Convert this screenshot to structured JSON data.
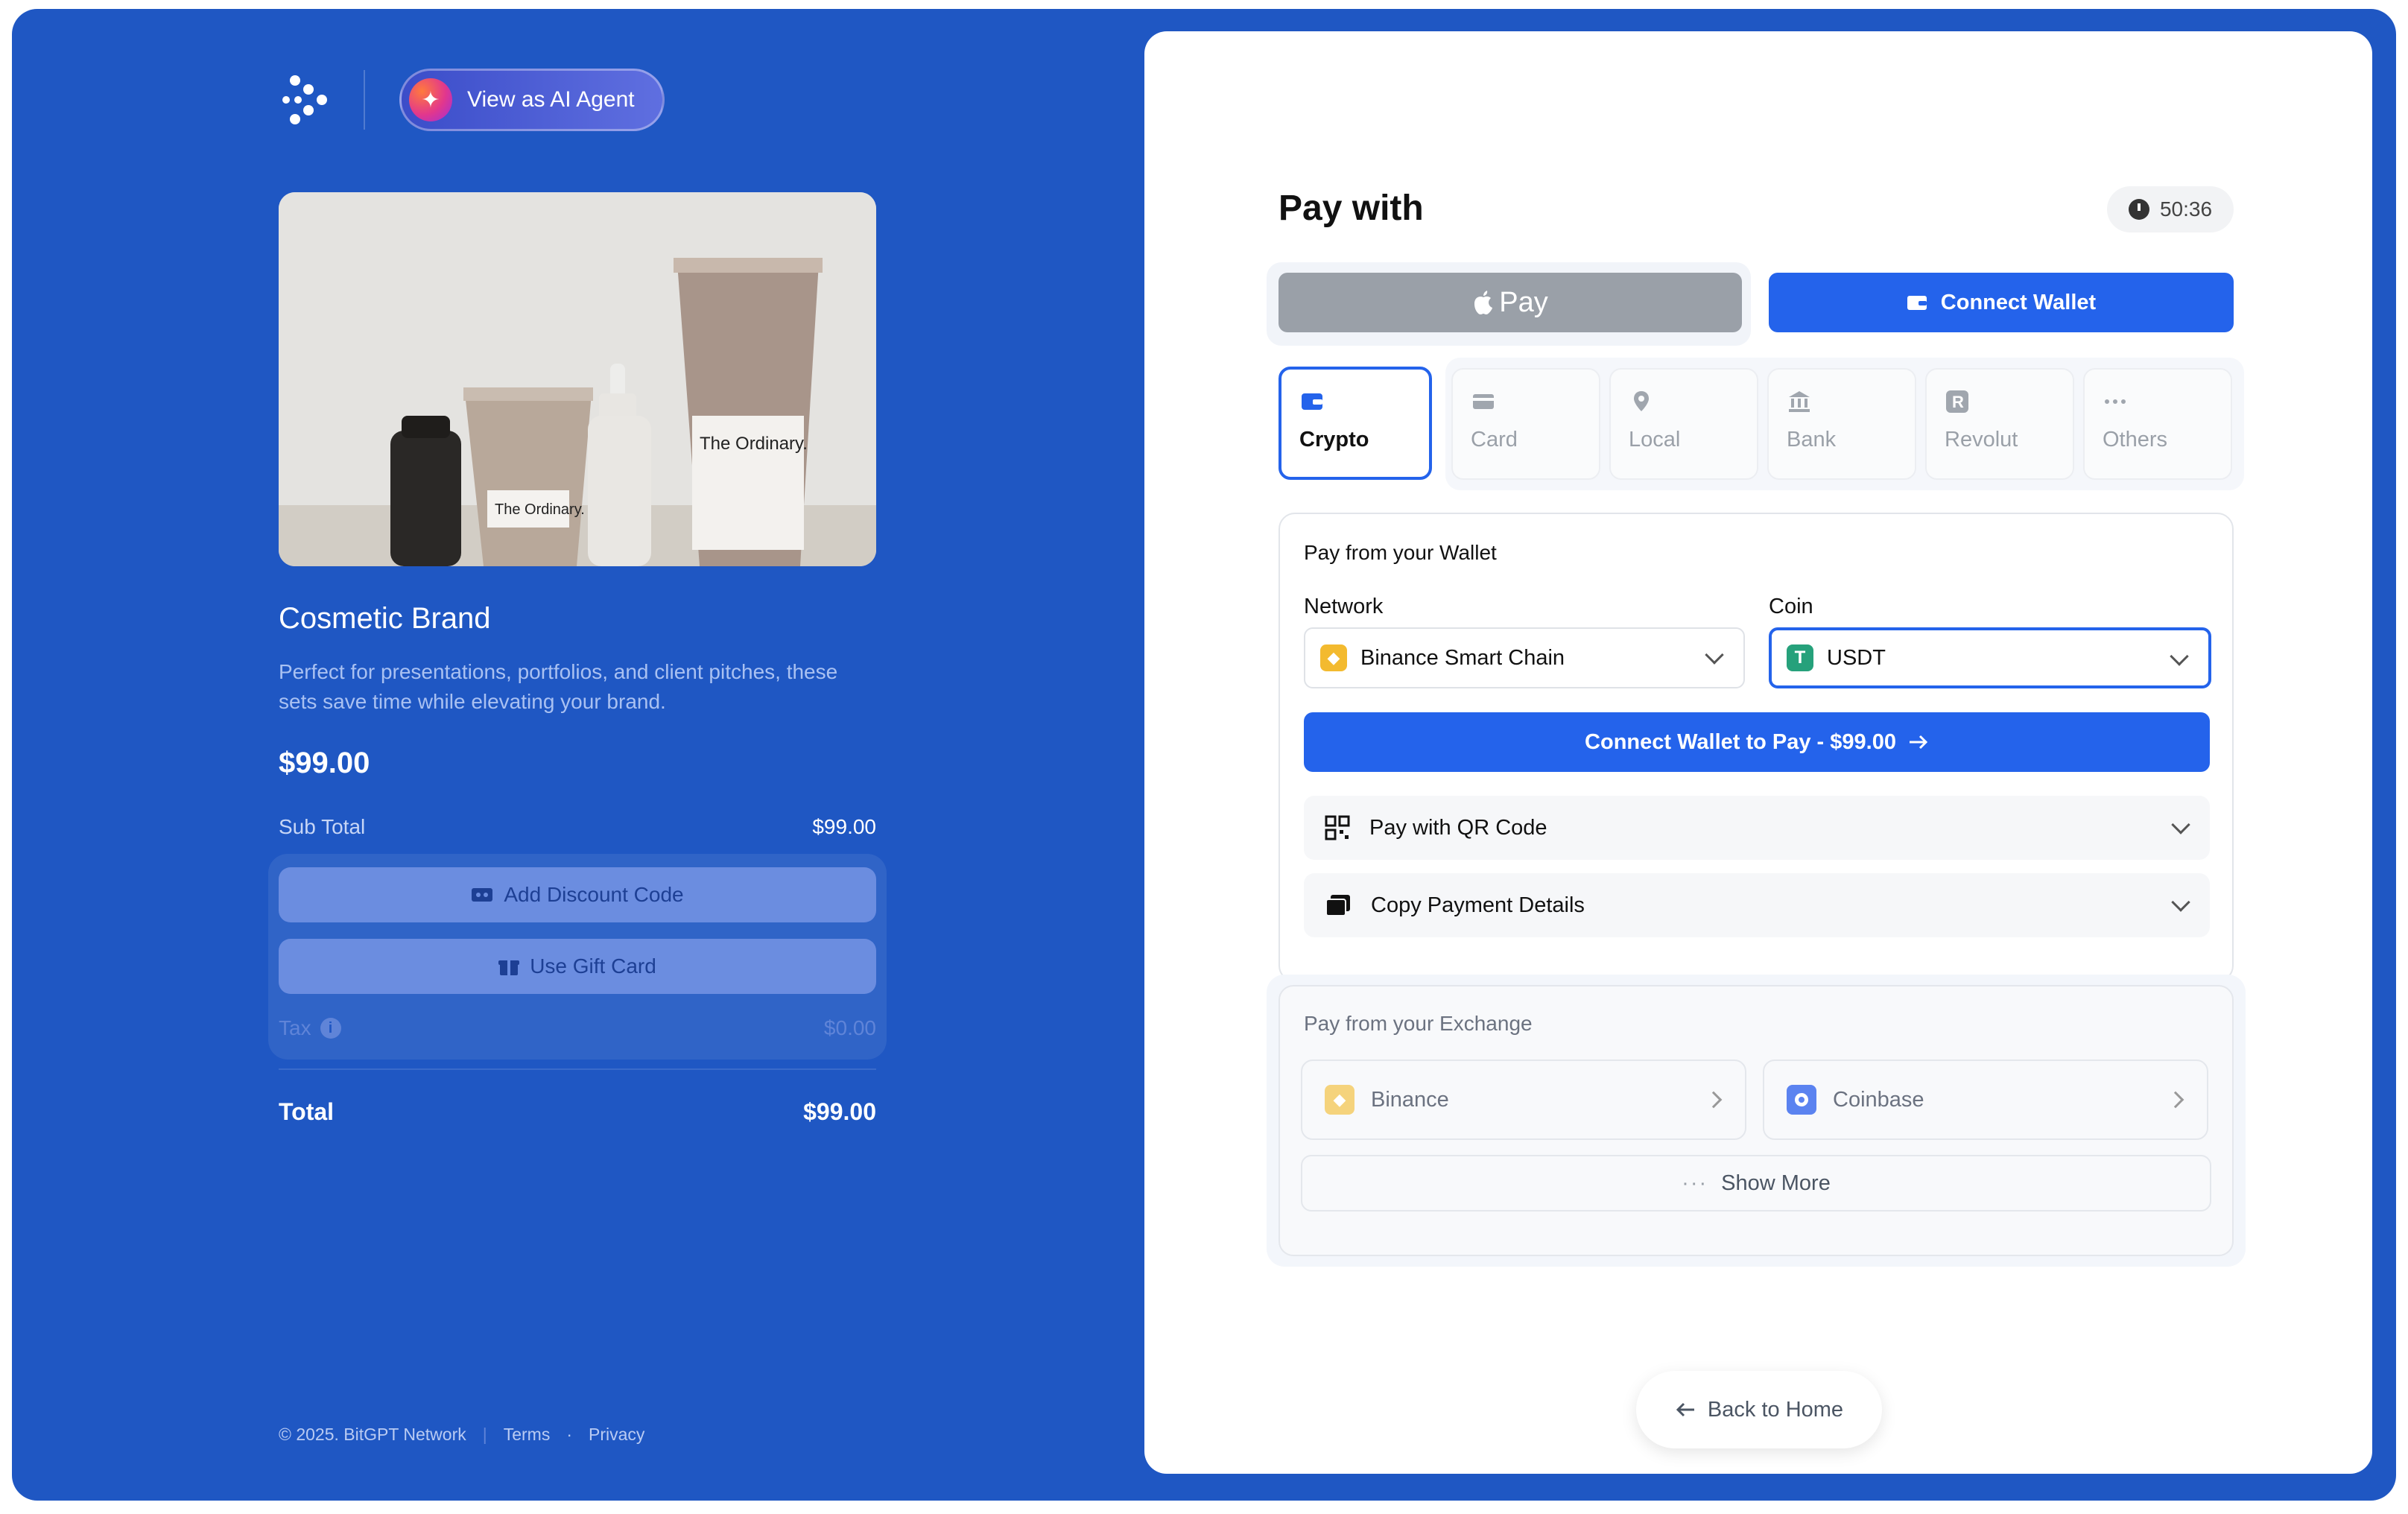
{
  "left": {
    "agent_button_label": "View as AI Agent",
    "product": {
      "title": "Cosmetic Brand",
      "description": "Perfect for presentations, portfolios, and client pitches, these sets save time while elevating your brand.",
      "price": "$99.00",
      "image_brand_text": "The Ordinary."
    },
    "summary": {
      "subtotal_label": "Sub Total",
      "subtotal_value": "$99.00",
      "discount_label": "Add Discount Code",
      "gift_label": "Use Gift Card",
      "tax_label": "Tax",
      "tax_value": "$0.00",
      "total_label": "Total",
      "total_value": "$99.00"
    },
    "footer": {
      "copyright": "© 2025. BitGPT Network",
      "terms": "Terms",
      "dot": "·",
      "privacy": "Privacy",
      "sep": "|"
    }
  },
  "right": {
    "title": "Pay with",
    "timer": "50:36",
    "apple_pay_label": "Pay",
    "connect_wallet_label": "Connect Wallet",
    "tabs": [
      {
        "label": "Crypto",
        "icon": "wallet-icon",
        "active": true
      },
      {
        "label": "Card",
        "icon": "card-icon"
      },
      {
        "label": "Local",
        "icon": "location-icon"
      },
      {
        "label": "Bank",
        "icon": "bank-icon"
      },
      {
        "label": "Revolut",
        "icon": "revolut-icon"
      },
      {
        "label": "Others",
        "icon": "more-icon"
      }
    ],
    "wallet": {
      "title": "Pay from your Wallet",
      "network_label": "Network",
      "network_value": "Binance Smart Chain",
      "coin_label": "Coin",
      "coin_value": "USDT",
      "pay_button": "Connect Wallet to Pay - $99.00",
      "qr_label": "Pay with QR Code",
      "copy_label": "Copy Payment Details"
    },
    "exchange": {
      "title": "Pay from your Exchange",
      "options": [
        "Binance",
        "Coinbase"
      ],
      "show_more": "Show More"
    },
    "back_home": "Back to Home"
  },
  "colors": {
    "brand_blue": "#1f57c3",
    "accent": "#2463eb",
    "binance": "#f3ba2f",
    "tether": "#26a17b"
  }
}
